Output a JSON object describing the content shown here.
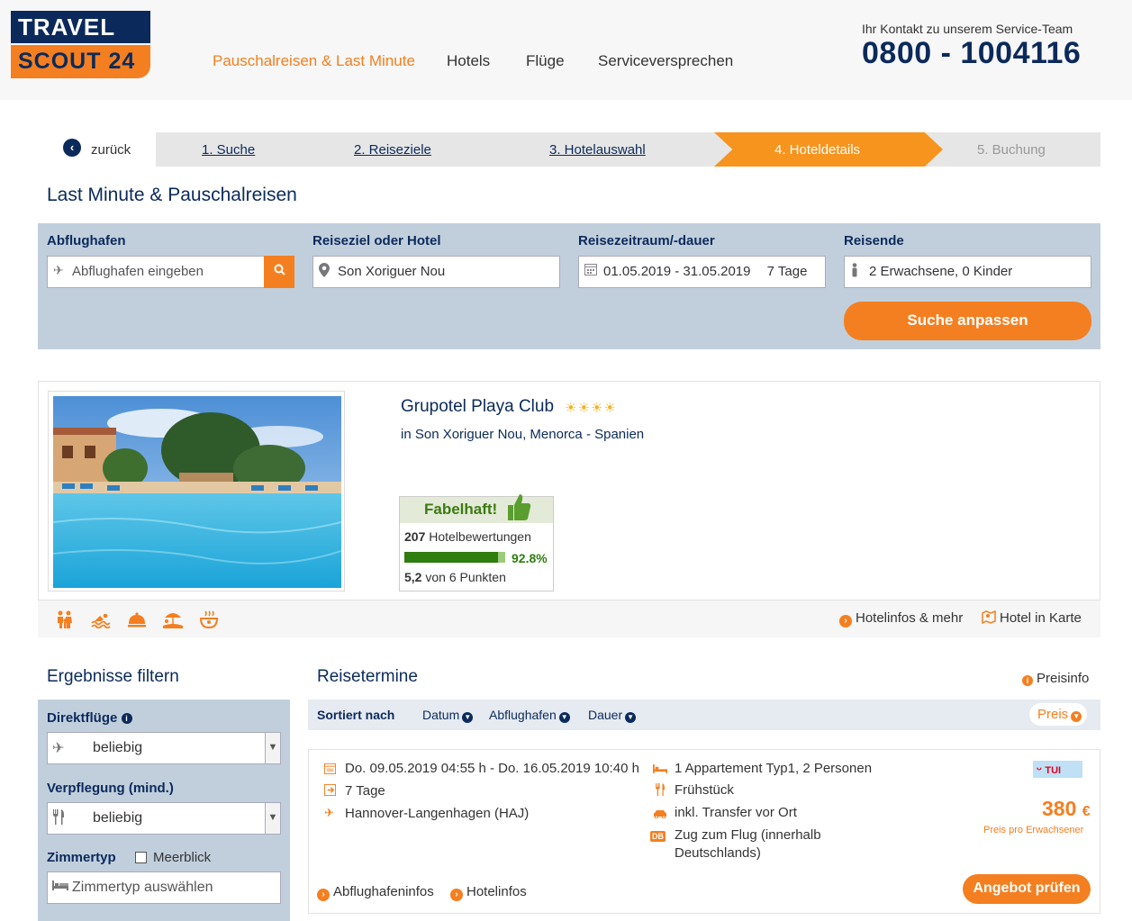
{
  "header": {
    "logo_line1": "TRAVEL",
    "logo_line2": "SCOUT 24",
    "nav": [
      "Pauschalreisen & Last Minute",
      "Hotels",
      "Flüge",
      "Serviceversprechen"
    ],
    "contact_label": "Ihr Kontakt zu unserem Service-Team",
    "phone": "0800 - 1004116"
  },
  "steps": {
    "back_label": "zurück",
    "items": [
      "1. Suche",
      "2. Reiseziele",
      "3. Hotelauswahl",
      "4. Hoteldetails",
      "5. Buchung"
    ],
    "active_index": 3
  },
  "page_title": "Last Minute & Pauschalreisen",
  "search": {
    "departure_label": "Abflughafen",
    "departure_placeholder": "Abflughafen eingeben",
    "destination_label": "Reiseziel oder Hotel",
    "destination_value": "Son Xoriguer Nou",
    "period_label": "Reisezeitraum/-dauer",
    "period_value": "01.05.2019 - 31.05.2019",
    "duration_value": "7 Tage",
    "travellers_label": "Reisende",
    "travellers_value": "2 Erwachsene, 0 Kinder",
    "submit_label": "Suche anpassen"
  },
  "hotel": {
    "name": "Grupotel Playa Club",
    "stars": "☀☀☀☀",
    "location": "in Son Xoriguer Nou, Menorca - Spanien",
    "rating_title": "Fabelhaft!",
    "reviews_count": "207",
    "reviews_label": "Hotelbewertungen",
    "recommend_pct": "92.8%",
    "recommend_fraction": 0.928,
    "score": "5,2",
    "score_suffix": "von 6 Punkten",
    "links": [
      "Hotelinfos & mehr",
      "Hotel in Karte"
    ],
    "amenity_icons": [
      "family-icon",
      "swimming-icon",
      "room-service-icon",
      "beach-icon",
      "spa-icon"
    ]
  },
  "filters": {
    "title": "Ergebnisse filtern",
    "direct_label": "Direktflüge",
    "direct_value": "beliebig",
    "board_label": "Verpflegung (mind.)",
    "board_value": "beliebig",
    "room_label": "Zimmertyp",
    "sea_view_label": "Meerblick",
    "room_placeholder": "Zimmertyp auswählen"
  },
  "results": {
    "title": "Reisetermine",
    "price_info": "Preisinfo",
    "sort_label": "Sortiert nach",
    "sort_options": [
      "Datum",
      "Abflughafen",
      "Dauer",
      "Preis"
    ],
    "offer": {
      "dates": "Do. 09.05.2019 04:55 h - Do. 16.05.2019 10:40 h",
      "duration": "7 Tage",
      "airport": "Hannover-Langenhagen (HAJ)",
      "room": "1 Appartement Typ1, 2 Personen",
      "board": "Frühstück",
      "transfer": "inkl. Transfer vor Ort",
      "train_badge": "DB",
      "train_line1": "Zug zum Flug (innerhalb",
      "train_line2": "Deutschlands)",
      "operator": "TUI",
      "price": "380",
      "currency": "€",
      "price_note": "Preis pro Erwachsener",
      "cta": "Angebot prüfen",
      "links": [
        "Abflughafeninfos",
        "Hotelinfos"
      ]
    }
  }
}
